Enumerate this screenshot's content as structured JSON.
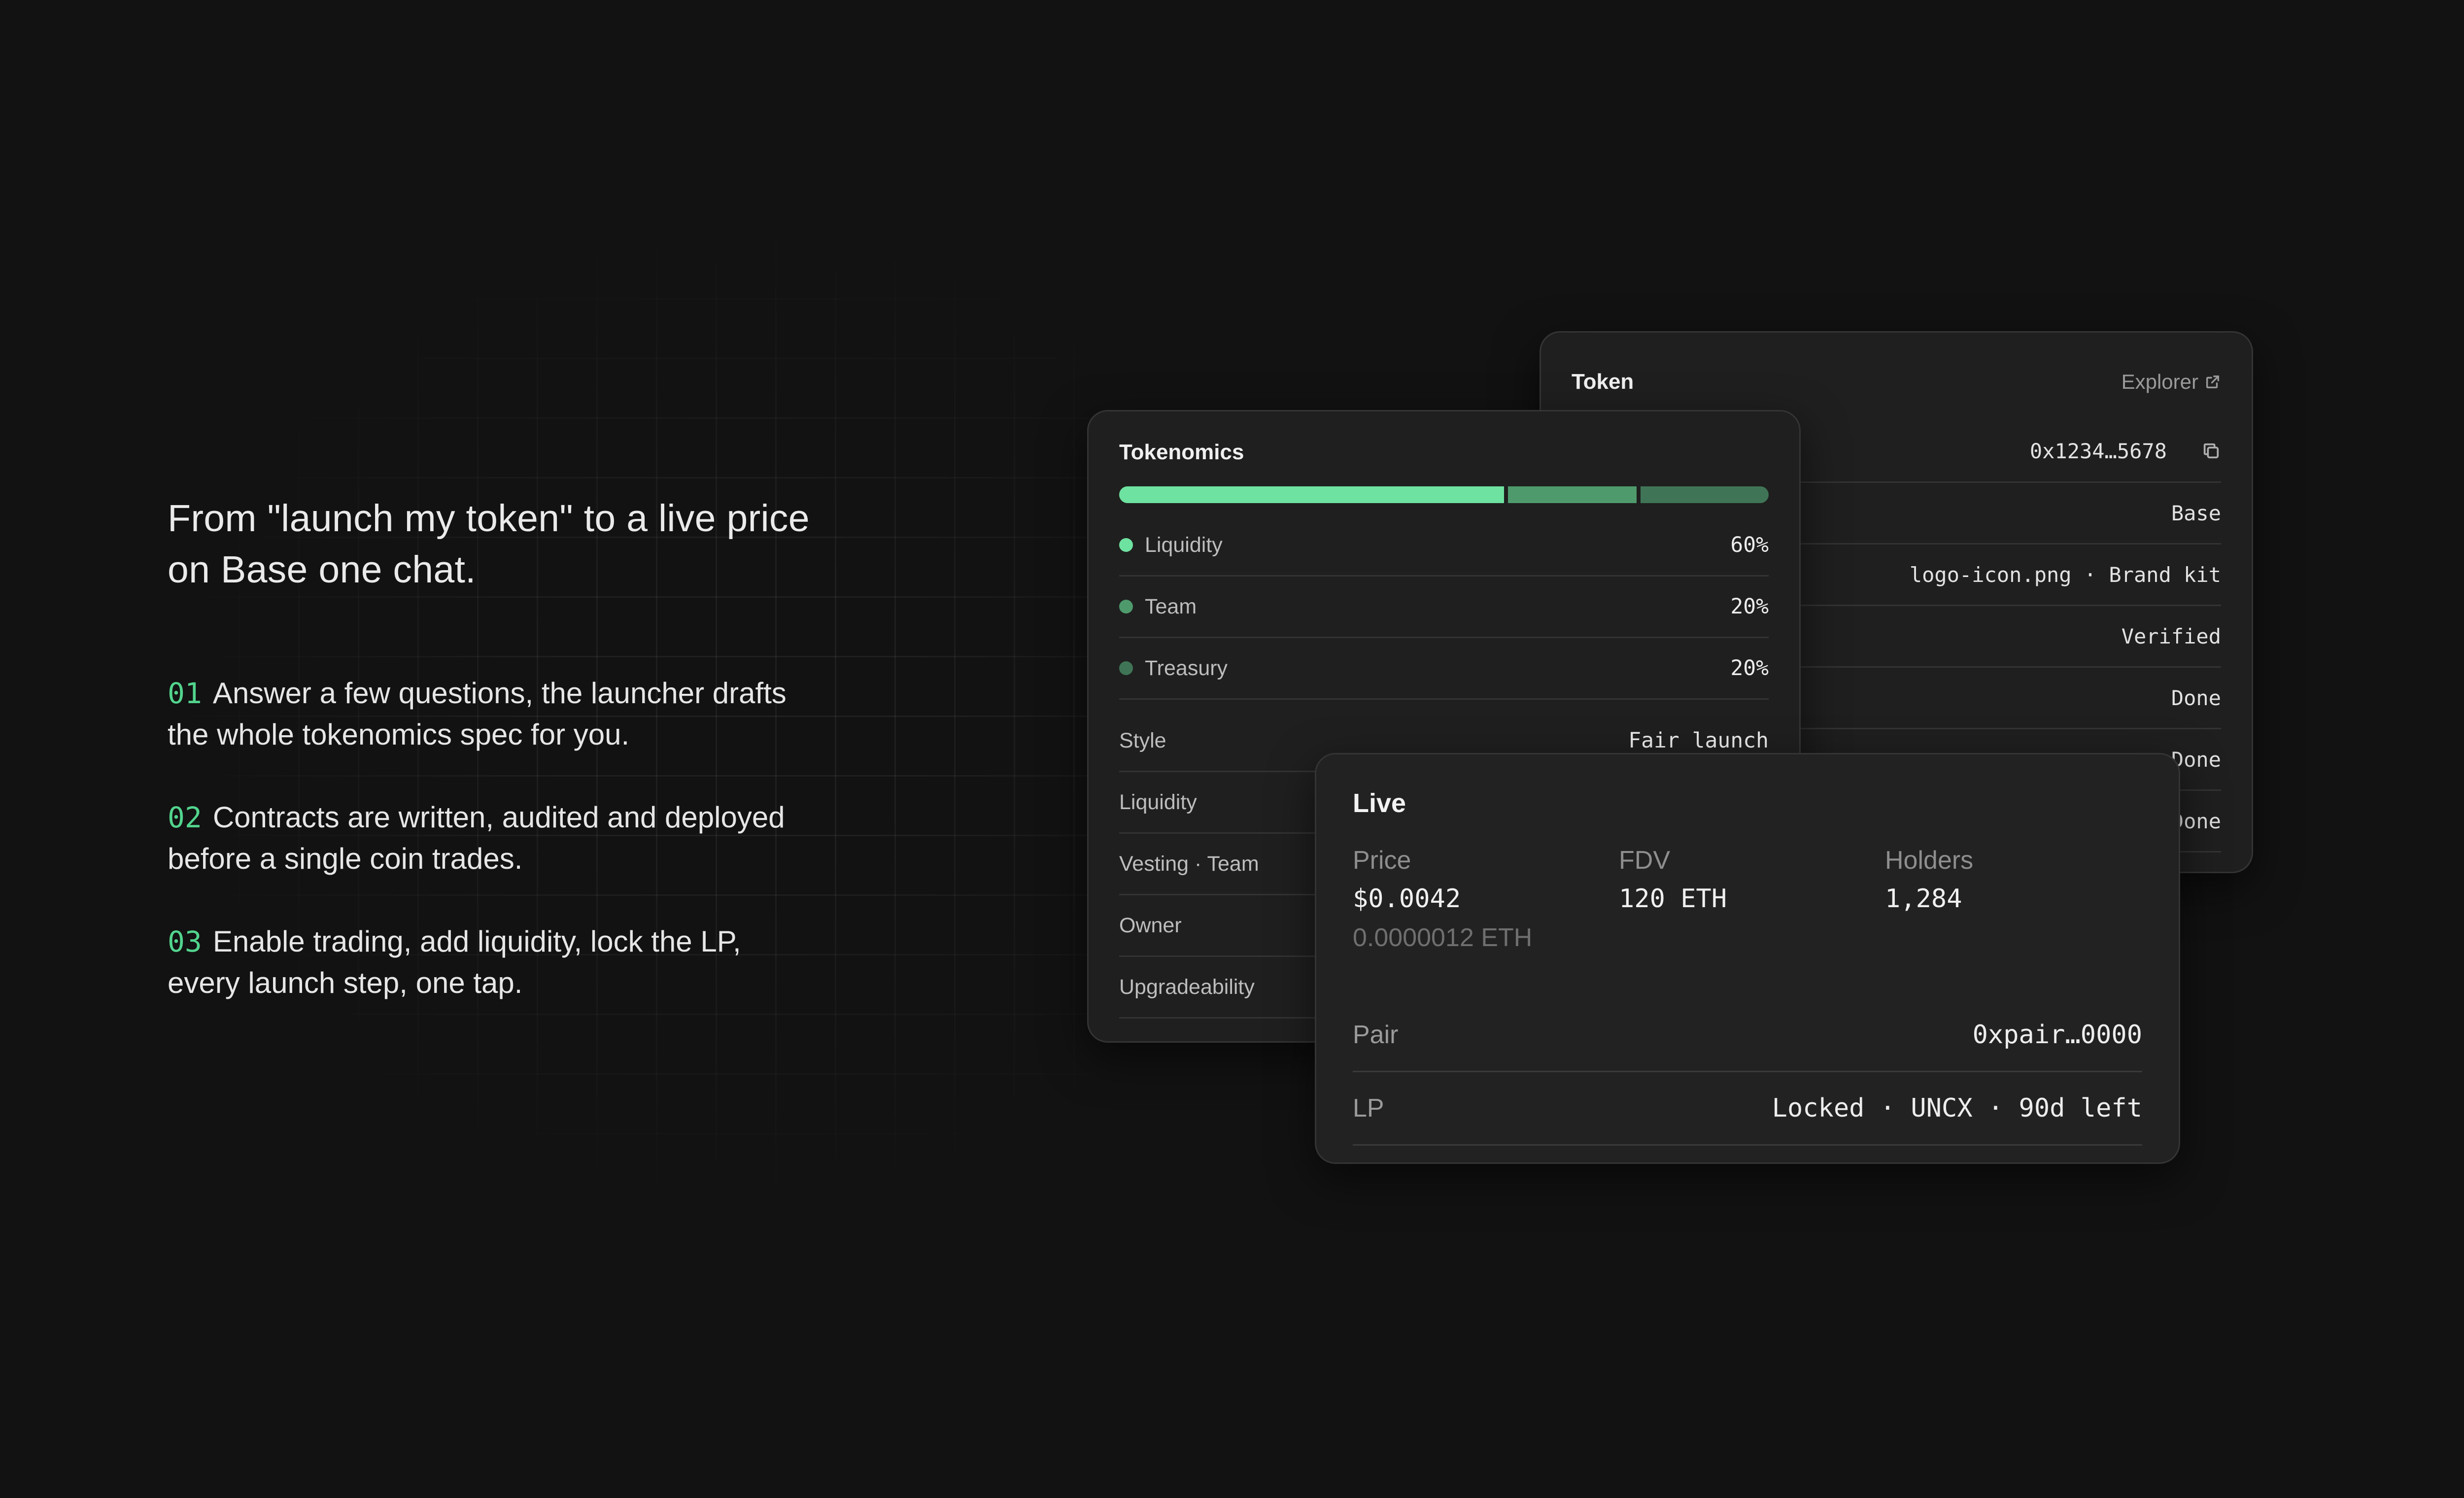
{
  "hero": {
    "headline_line1": "From \"launch my token\" to a live price",
    "headline_line2": "on Base one chat.",
    "steps": [
      {
        "num": "01",
        "line1": "Answer a few questions, the launcher drafts",
        "line2": "the whole tokenomics spec for you."
      },
      {
        "num": "02",
        "line1": "Contracts are written, audited and deployed",
        "line2": "before a single coin trades."
      },
      {
        "num": "03",
        "line1": "Enable trading, add liquidity, lock the LP,",
        "line2": "every launch step, one tap."
      }
    ]
  },
  "token_card": {
    "title": "Token",
    "explorer_label": "Explorer",
    "address": "0x1234…5678",
    "rows": [
      "Base",
      "logo-icon.png · Brand kit",
      "Verified",
      "Done",
      "Done",
      "Done"
    ]
  },
  "tokenomics_card": {
    "title": "Tokenomics",
    "allocations": [
      {
        "label": "Liquidity",
        "value": "60%",
        "fraction": 0.6,
        "color": "#6ee2a0"
      },
      {
        "label": "Team",
        "value": "20%",
        "fraction": 0.2,
        "color": "#4e9a6c"
      },
      {
        "label": "Treasury",
        "value": "20%",
        "fraction": 0.2,
        "color": "#3f7556"
      }
    ],
    "details": [
      {
        "label": "Style",
        "value": "Fair launch"
      },
      {
        "label": "Liquidity",
        "value": ""
      },
      {
        "label": "Vesting · Team",
        "value": ""
      },
      {
        "label": "Owner",
        "value": ""
      },
      {
        "label": "Upgradeability",
        "value": ""
      }
    ]
  },
  "live_card": {
    "title": "Live",
    "price_label": "Price",
    "price_value": "$0.0042",
    "price_sub": "0.0000012 ETH",
    "fdv_label": "FDV",
    "fdv_value": "120 ETH",
    "holders_label": "Holders",
    "holders_value": "1,284",
    "pair_label": "Pair",
    "pair_value": "0xpair…0000",
    "lp_label": "LP",
    "lp_value": "Locked · UNCX · 90d left"
  },
  "colors": {
    "accent": "#52d48d",
    "background": "#121212",
    "card": "#1f1f1f"
  }
}
